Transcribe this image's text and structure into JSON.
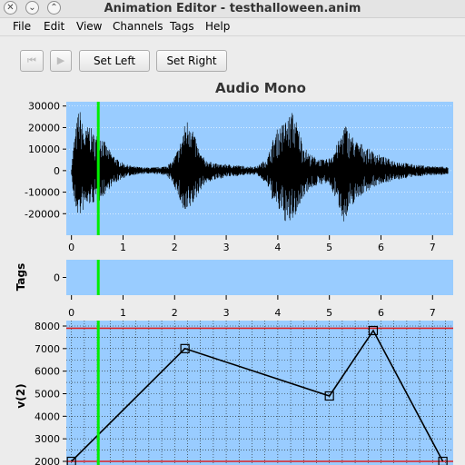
{
  "window": {
    "title": "Animation Editor - testhalloween.anim",
    "controls": [
      "close-icon",
      "chevron-down-icon",
      "chevron-up-icon"
    ]
  },
  "menu": [
    "File",
    "Edit",
    "View",
    "Channels",
    "Tags",
    "Help"
  ],
  "toolbar": {
    "rewind_icon": "skip-back-icon",
    "play_icon": "play-icon",
    "set_left": "Set Left",
    "set_right": "Set Right"
  },
  "colors": {
    "plot_bg": "#99ccff",
    "waveform": "#000000",
    "playhead": "#00ee00",
    "limit_line": "#dd2222",
    "curve": "#000000"
  },
  "playhead_time": 0.52,
  "chart_data": [
    {
      "type": "line",
      "title": "Audio Mono",
      "xlabel": "",
      "ylabel": "",
      "xlim": [
        -0.1,
        7.4
      ],
      "ylim": [
        -30000,
        32000
      ],
      "x_ticks": [
        "0",
        "1",
        "2",
        "3",
        "4",
        "5",
        "6",
        "7"
      ],
      "y_ticks": [
        "30000",
        "20000",
        "10000",
        "0",
        "-10000",
        "-20000"
      ],
      "envelope": {
        "x": [
          0.0,
          0.05,
          0.15,
          0.25,
          0.35,
          0.45,
          0.55,
          0.65,
          0.75,
          0.9,
          1.05,
          1.2,
          1.4,
          1.6,
          1.8,
          1.95,
          2.1,
          2.2,
          2.3,
          2.4,
          2.5,
          2.6,
          2.7,
          2.85,
          3.0,
          3.2,
          3.4,
          3.6,
          3.8,
          3.9,
          4.0,
          4.1,
          4.2,
          4.3,
          4.4,
          4.5,
          4.6,
          4.75,
          4.9,
          5.0,
          5.1,
          5.2,
          5.3,
          5.4,
          5.5,
          5.6,
          5.7,
          5.85,
          6.0,
          6.2,
          6.4,
          6.6,
          6.8,
          7.0,
          7.2,
          7.3
        ],
        "max": [
          2000,
          14000,
          30000,
          18000,
          22000,
          16000,
          18000,
          13000,
          9000,
          5000,
          3000,
          2000,
          1500,
          1500,
          2000,
          4000,
          12000,
          22000,
          26000,
          15000,
          8000,
          5000,
          4000,
          3000,
          3000,
          2500,
          2000,
          2000,
          6000,
          14000,
          20000,
          22000,
          25000,
          28000,
          20000,
          12000,
          8000,
          6000,
          5000,
          6000,
          10000,
          15000,
          22000,
          18000,
          14000,
          13000,
          11000,
          9000,
          7000,
          5000,
          4000,
          3000,
          2500,
          2000,
          2000,
          1500
        ],
        "min": [
          -2000,
          -16000,
          -22000,
          -18000,
          -16000,
          -15000,
          -14000,
          -11000,
          -8000,
          -5000,
          -3000,
          -2000,
          -1500,
          -1500,
          -2000,
          -5000,
          -14000,
          -22000,
          -18000,
          -14000,
          -9000,
          -6000,
          -5000,
          -4000,
          -3000,
          -2500,
          -2000,
          -2000,
          -7000,
          -14000,
          -18000,
          -22000,
          -26000,
          -23000,
          -18000,
          -12000,
          -9000,
          -7000,
          -6000,
          -7000,
          -12000,
          -18000,
          -25000,
          -19000,
          -14000,
          -12000,
          -10000,
          -8000,
          -6000,
          -5000,
          -4000,
          -3000,
          -2500,
          -2000,
          -2000,
          -1500
        ]
      }
    },
    {
      "type": "line",
      "title": "",
      "ylabel": "Tags",
      "xlim": [
        -0.1,
        7.4
      ],
      "x_ticks": [
        "0",
        "1",
        "2",
        "3",
        "4",
        "5",
        "6",
        "7"
      ],
      "y_ticks": [
        "0"
      ]
    },
    {
      "type": "line",
      "title": "",
      "ylabel": "v(2)",
      "xlim": [
        -0.1,
        7.4
      ],
      "ylim": [
        2000,
        8000
      ],
      "y_ticks": [
        "8000",
        "7000",
        "6000",
        "5000",
        "4000",
        "3000",
        "2000"
      ],
      "limits": [
        2000,
        7900
      ],
      "series": [
        {
          "x": [
            0.0,
            2.2,
            5.0,
            5.85,
            7.2
          ],
          "y": [
            2000,
            7000,
            4900,
            7800,
            2000
          ]
        }
      ]
    }
  ]
}
